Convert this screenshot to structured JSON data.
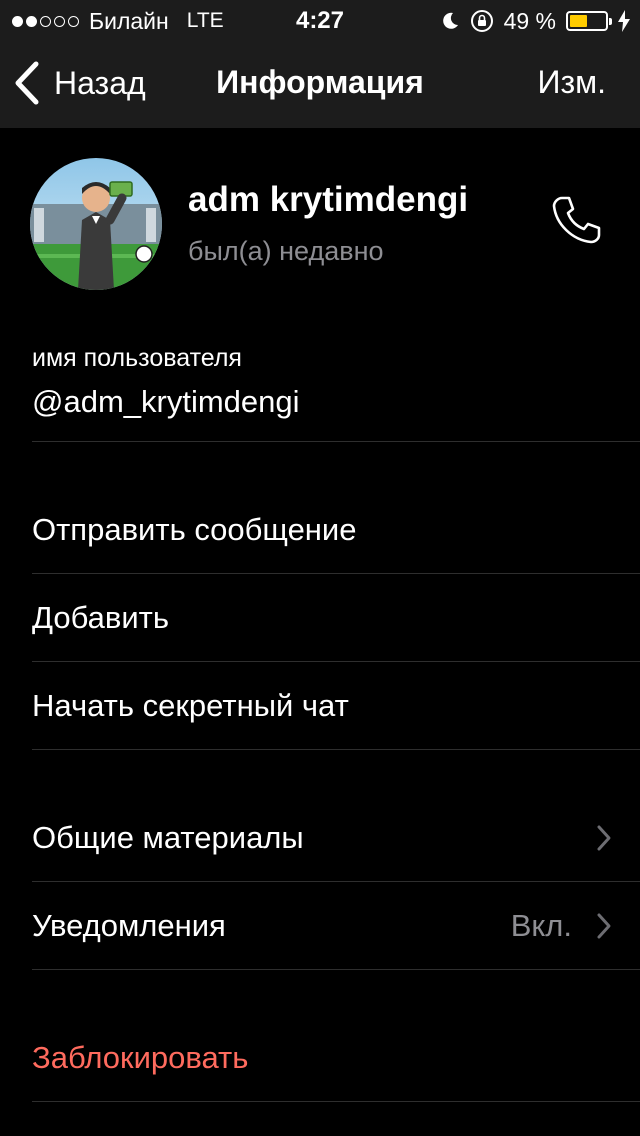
{
  "status_bar": {
    "signal_filled": 2,
    "signal_total": 5,
    "carrier": "Билайн",
    "network": "LTE",
    "time": "4:27",
    "battery_text": "49 %",
    "battery_level": 0.49,
    "icons": [
      "moon-icon",
      "rotation-lock-icon",
      "battery-icon",
      "charging-bolt-icon"
    ]
  },
  "nav": {
    "back_label": "Назад",
    "title": "Информация",
    "edit_label": "Изм."
  },
  "profile": {
    "name": "adm krytimdengi",
    "status": "был(а) недавно"
  },
  "username": {
    "label": "имя пользователя",
    "value": "@adm_krytimdengi"
  },
  "actions": [
    {
      "label": "Отправить сообщение"
    },
    {
      "label": "Добавить"
    },
    {
      "label": "Начать секретный чат"
    }
  ],
  "settings": [
    {
      "label": "Общие материалы",
      "value": ""
    },
    {
      "label": "Уведомления",
      "value": "Вкл."
    }
  ],
  "block": {
    "label": "Заблокировать"
  },
  "colors": {
    "background": "#000000",
    "bar_background": "#1c1c1c",
    "secondary_text": "#8e8e93",
    "danger": "#ff6b5e",
    "battery": "#ffcc00"
  }
}
